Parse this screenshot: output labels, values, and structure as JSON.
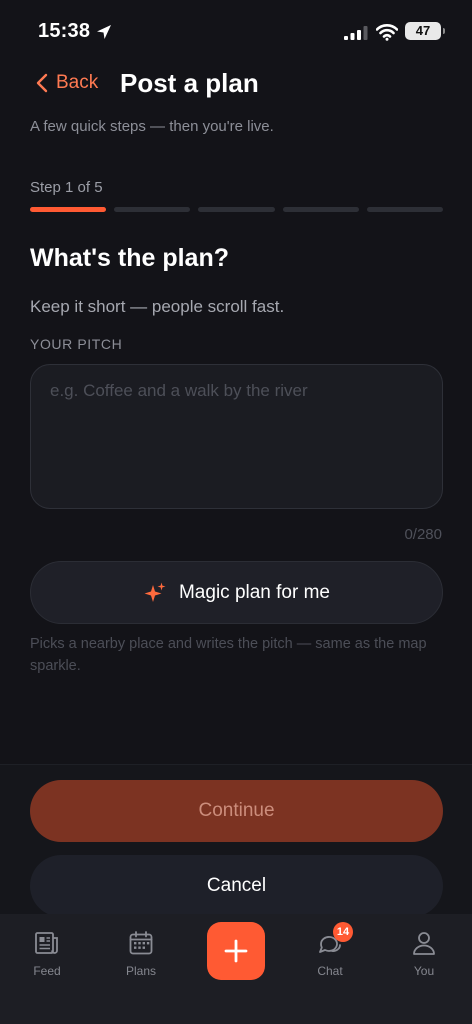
{
  "status_bar": {
    "time": "15:38",
    "battery": "47"
  },
  "header": {
    "back_label": "Back",
    "title": "Post a plan",
    "subtitle": "A few quick steps — then you're live."
  },
  "progress": {
    "step_label": "Step 1 of 5",
    "current_step": 1,
    "total_steps": 5
  },
  "question": {
    "title": "What's the plan?",
    "hint": "Keep it short — people scroll fast.",
    "field_label": "YOUR PITCH",
    "placeholder": "e.g. Coffee and a walk by the river",
    "value": "",
    "char_count": "0/280"
  },
  "magic": {
    "button_label": "Magic plan for me",
    "note": "Picks a nearby place and writes the pitch — same as the map sparkle."
  },
  "actions": {
    "continue_label": "Continue",
    "cancel_label": "Cancel"
  },
  "colors": {
    "accent": "#ff5a33",
    "continue_disabled": "#7c3322",
    "background": "#131318"
  },
  "tab_bar": {
    "items": [
      {
        "label": "Feed",
        "icon": "newspaper-icon"
      },
      {
        "label": "Plans",
        "icon": "calendar-icon"
      },
      {
        "label": "Chat",
        "icon": "chat-bubbles-icon",
        "badge": "14"
      },
      {
        "label": "You",
        "icon": "user-icon"
      }
    ],
    "add_icon": "plus-icon"
  }
}
